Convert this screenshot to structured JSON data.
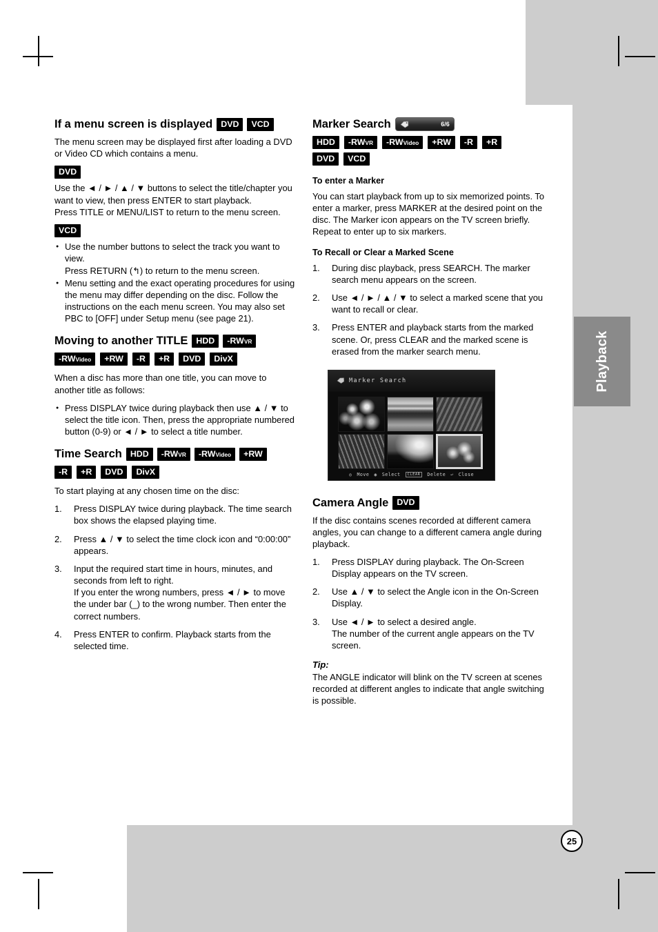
{
  "page": {
    "number": "25",
    "side_tab": "Playback"
  },
  "left_column": {
    "section1": {
      "heading": "If a menu screen is displayed",
      "heading_badges": [
        "DVD",
        "VCD"
      ],
      "intro": "The menu screen may be displayed first after loading a DVD or Video CD which contains a menu.",
      "dvd_badge": "DVD",
      "dvd_text_1": "Use the ◄ / ► / ▲ / ▼ buttons to select the title/chapter you want to view, then press ENTER to start playback.",
      "dvd_text_2": "Press TITLE or MENU/LIST to return to the menu screen.",
      "vcd_badge": "VCD",
      "vcd_bullets": [
        "Use the number buttons to select the track you want to view.\nPress RETURN (↰) to return to the menu screen.",
        "Menu setting and the exact operating procedures for using the menu may differ depending on the disc. Follow the instructions on the each menu screen. You may also set PBC to [OFF] under Setup menu (see page 21)."
      ]
    },
    "section2": {
      "heading": "Moving to another TITLE",
      "badges_inline": [
        "HDD",
        "-RWVR"
      ],
      "badges_row": [
        "-RWVideo",
        "+RW",
        "-R",
        "+R",
        "DVD",
        "DivX"
      ],
      "intro": "When a disc has more than one title, you can move to another title as follows:",
      "bullets": [
        "Press DISPLAY twice during playback then use ▲ / ▼ to select the title icon. Then, press the appropriate numbered button (0-9) or ◄ / ► to select a title number."
      ]
    },
    "section3": {
      "heading": "Time Search",
      "badges_inline": [
        "HDD",
        "-RWVR",
        "-RWVideo",
        "+RW"
      ],
      "badges_row": [
        "-R",
        "+R",
        "DVD",
        "DivX"
      ],
      "intro": "To start playing at any chosen time on the disc:",
      "steps": [
        "Press DISPLAY twice during playback. The time search box shows the elapsed playing time.",
        "Press ▲ / ▼ to select the time clock icon and “0:00:00” appears.",
        "Input the required start time in hours, minutes, and seconds from left to right.\nIf you enter the wrong numbers, press ◄ / ► to move the under bar (_) to the wrong number. Then enter the correct numbers.",
        "Press ENTER to confirm. Playback starts from the selected time."
      ]
    }
  },
  "right_column": {
    "marker_search": {
      "heading": "Marker Search",
      "marker_badge_count": "6/6",
      "badges_row1": [
        "HDD",
        "-RWVR",
        "-RWVideo",
        "+RW",
        "-R",
        "+R"
      ],
      "badges_row2": [
        "DVD",
        "VCD"
      ],
      "sub1": "To enter a Marker",
      "sub1_text": "You can start playback from up to six memorized points. To enter a marker, press MARKER at the desired point on the disc. The Marker icon appears on the TV screen briefly. Repeat to enter up to six markers.",
      "sub2": "To Recall or Clear a Marked Scene",
      "steps": [
        "During disc playback, press SEARCH. The marker search menu appears on the screen.",
        "Use ◄ / ► / ▲ / ▼ to select a marked scene that you want to recall or clear.",
        "Press ENTER and playback starts from the marked scene. Or, press CLEAR and the marked scene is erased from the marker search menu."
      ]
    },
    "osd_screenshot": {
      "title": "Marker Search",
      "footer": {
        "move": "Move",
        "select": "Select",
        "delete_key": "CLEAR",
        "delete": "Delete",
        "close": "Close"
      },
      "thumbnails": [
        {
          "index": 1,
          "selected": false
        },
        {
          "index": 2,
          "selected": false
        },
        {
          "index": 3,
          "selected": false
        },
        {
          "index": 4,
          "selected": false
        },
        {
          "index": 5,
          "selected": false
        },
        {
          "index": 6,
          "selected": true
        }
      ]
    },
    "camera_angle": {
      "heading": "Camera Angle",
      "heading_badge": "DVD",
      "intro": "If the disc contains scenes recorded at different camera angles, you can change to a different camera angle during playback.",
      "steps": [
        "Press DISPLAY during playback. The On-Screen Display appears on the TV screen.",
        "Use ▲ / ▼ to select the Angle icon in the On-Screen Display.",
        "Use ◄ / ► to select a desired angle.\nThe number of the current angle appears on the TV screen."
      ],
      "tip_label": "Tip:",
      "tip_text": "The ANGLE indicator will blink on the TV screen at scenes recorded at different angles to indicate that angle switching is possible."
    }
  },
  "colors": {
    "badge_bg": "#000000",
    "side_tab_bg": "#8a8a8a",
    "page_grey": "#cdcdcd"
  }
}
